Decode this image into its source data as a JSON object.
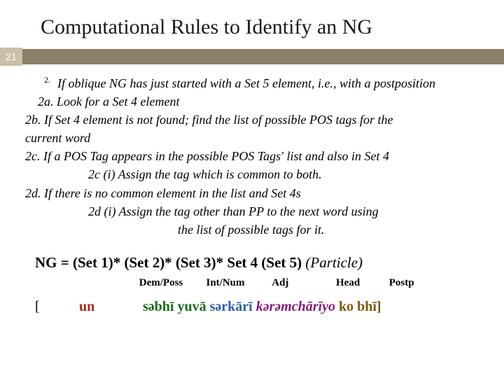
{
  "slide_number": "21",
  "title": "Computational Rules to Identify an NG",
  "bullet_number": "2.",
  "rules": {
    "r2": "If oblique NG has just started with a Set 5 element, i.e., with a postposition",
    "r2a": "2a. Look for a Set 4 element",
    "r2b": "2b. If Set 4 element is not found; find the list of possible POS tags for the",
    "r2b2": "current word",
    "r2c": "2c. If a POS Tag appears in the possible POS Tags' list and also in Set 4",
    "r2ci": "2c (i) Assign the tag which is common to both.",
    "r2d": "2d. If there is no common element in the list and Set 4s",
    "r2di": "2d (i) Assign the tag other than PP to the next word using",
    "r2di2": "the list of possible tags for it."
  },
  "formula": {
    "lhs": "NG  =  ",
    "s1": "(Set 1)* ",
    "s2": "(Set 2)* ",
    "s3": "(Set 3)*  ",
    "s4": "Set 4  ",
    "s5": "(Set 5) ",
    "particle": "(Particle)"
  },
  "labels": {
    "dem": "Dem/Poss",
    "int": "Int/Num",
    "adj": "Adj",
    "head": "Head",
    "postp": "Postp"
  },
  "example": {
    "open": "[",
    "dem": "un",
    "int": "səbhī",
    "int2": "yuvā",
    "adj": "sərkārī",
    "head": "kərəmchārīyo",
    "postp": "ko bhī]"
  }
}
